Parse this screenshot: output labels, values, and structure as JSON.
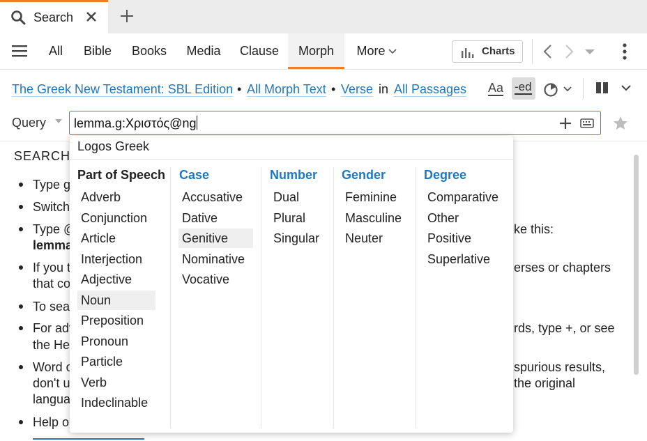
{
  "tab": {
    "title": "Search",
    "icon": "search-icon"
  },
  "nav": {
    "tabs": [
      {
        "label": "All"
      },
      {
        "label": "Bible"
      },
      {
        "label": "Books"
      },
      {
        "label": "Media"
      },
      {
        "label": "Clause"
      },
      {
        "label": "Morph",
        "active": true
      },
      {
        "label": "More"
      }
    ],
    "charts_label": "Charts"
  },
  "resource_line": {
    "resource": "The Greek New Testament: SBL Edition",
    "text": "All Morph Text",
    "unit": "Verse",
    "in_word": "in",
    "range": "All Passages",
    "case_label": "Aa",
    "ed_label": "-ed"
  },
  "query": {
    "label": "Query",
    "value": "lemma.g:Χριστός@ng"
  },
  "help": {
    "heading": "SEARCH",
    "lines": [
      "Type g",
      "Switch",
      "Type @",
      "lemma",
      "ke this:",
      "If you t",
      "that co",
      "erses or chapters",
      "To sea",
      "For adv",
      "the He",
      "rds, type +, or see",
      "Word o",
      "don't u",
      "langua",
      "spurious results,",
      "the original",
      "Help o"
    ]
  },
  "popup": {
    "title": "Logos Greek",
    "columns": [
      {
        "heading": "Part of Speech",
        "items": [
          "Adverb",
          "Conjunction",
          "Article",
          "Interjection",
          "Adjective",
          "Noun",
          "Preposition",
          "Pronoun",
          "Particle",
          "Verb",
          "Indeclinable"
        ],
        "highlight": "Noun"
      },
      {
        "heading": "Case",
        "items": [
          "Accusative",
          "Dative",
          "Genitive",
          "Nominative",
          "Vocative"
        ],
        "highlight": "Genitive"
      },
      {
        "heading": "Number",
        "items": [
          "Dual",
          "Plural",
          "Singular"
        ]
      },
      {
        "heading": "Gender",
        "items": [
          "Feminine",
          "Masculine",
          "Neuter"
        ]
      },
      {
        "heading": "Degree",
        "items": [
          "Comparative",
          "Other",
          "Positive",
          "Superlative"
        ]
      }
    ]
  },
  "colors": {
    "accent": "#f07d2a",
    "link": "#1e78c2",
    "input_border": "#3a84c4"
  }
}
